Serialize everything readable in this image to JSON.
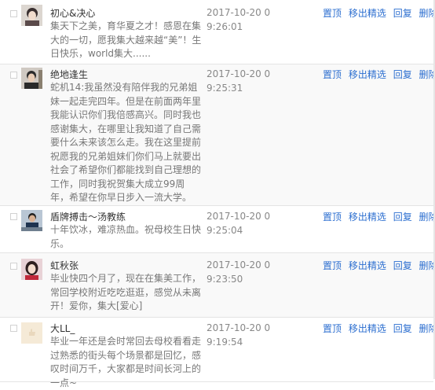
{
  "actions": {
    "pin": "置顶",
    "unfeature": "移出精选",
    "reply": "回复",
    "delete": "删除"
  },
  "comments": [
    {
      "name": "初心&决心",
      "content": "集天下之美，育华夏之才！感恩在集大的一切，愿我集大越来越“美”！生日快乐，world集大......",
      "time": "2017-10-20 09:26:01"
    },
    {
      "name": "绝地逢生",
      "content": "蛇机14:我虽然没有陪伴我的兄弟姐妹一起走完四年。但是在前面两年里我能认识你们我倍感高兴。同时我也感谢集大，在哪里让我知道了自己需要什么未来该怎么走。我在这里提前祝愿我的兄弟姐妹们你们马上就要出社会了希望你们都能找到自己理想的工作，同时我祝贺集大成立99周年，希望在你早日步入一流大学。",
      "time": "2017-10-20 09:25:31"
    },
    {
      "name": "盾牌搏击～汤教练",
      "content": "十年饮冰，难凉热血。祝母校生日快乐。",
      "time": "2017-10-20 09:25:04"
    },
    {
      "name": "虹秋张",
      "content": "毕业快四个月了，现在在集美工作，常回学校附近吃吃逛逛，感觉从未离开！爱你，集大[爱心]",
      "time": "2017-10-20 09:23:50"
    },
    {
      "name": "大LL_",
      "content": "毕业一年还是会时常回去母校看看走过熟悉的街头每个场景都是回忆，感叹时间万千，大家都是时间长河上的一点~",
      "time": "2017-10-20 09:19:54"
    }
  ]
}
